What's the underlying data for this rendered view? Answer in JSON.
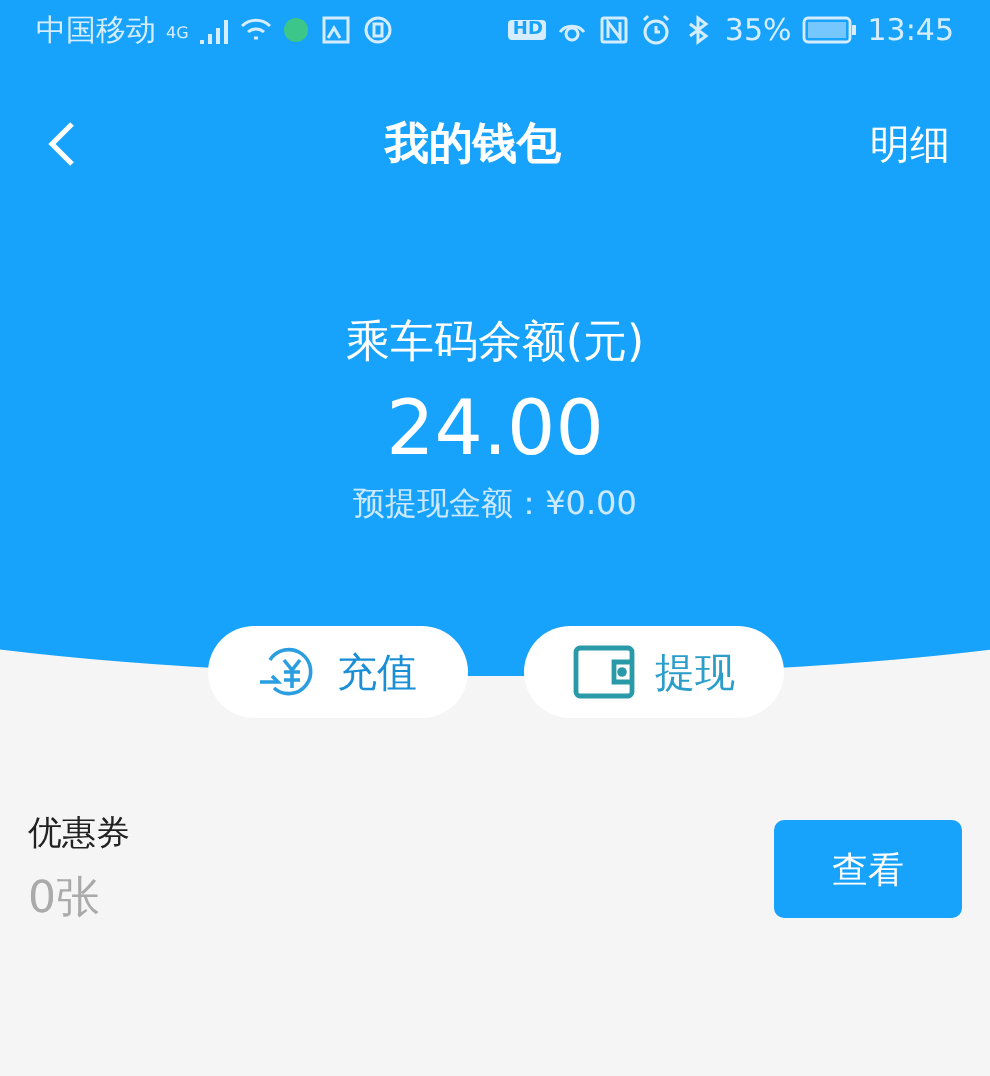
{
  "status_bar": {
    "carrier": "中国移动",
    "network": "4G",
    "hd_badge": "HD",
    "battery_percent": "35%",
    "time": "13:45"
  },
  "nav": {
    "title": "我的钱包",
    "action": "明细"
  },
  "balance": {
    "label": "乘车码余额(元)",
    "amount": "24.00",
    "pending": "预提现金额：¥0.00"
  },
  "actions": [
    {
      "kind": "recharge",
      "label": "充值"
    },
    {
      "kind": "withdraw",
      "label": "提现"
    }
  ],
  "coupon": {
    "label": "优惠券",
    "count": "0张",
    "button": "查看"
  }
}
